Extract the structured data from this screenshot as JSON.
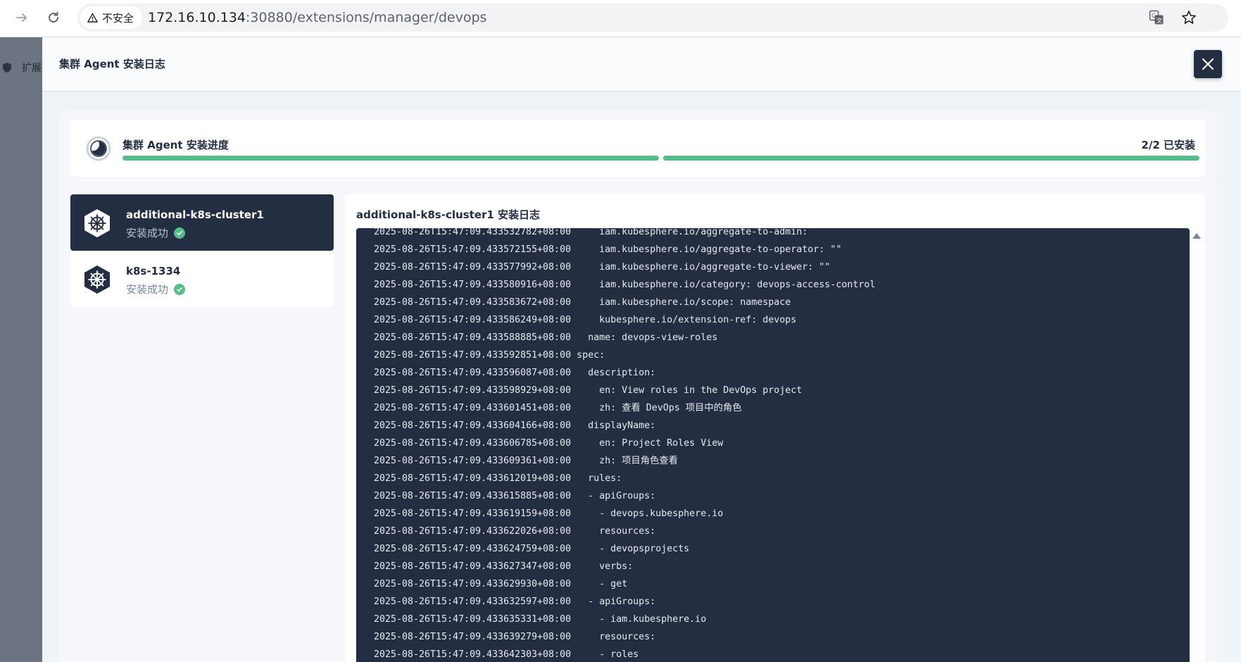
{
  "browser": {
    "security_label": "不安全",
    "url_host": "172.16.10.134",
    "url_path": ":30880/extensions/manager/devops"
  },
  "background": {
    "nav_label": "扩展"
  },
  "modal": {
    "title": "集群 Agent 安装日志",
    "progress": {
      "title": "集群 Agent 安装进度",
      "count_label": "2/2 已安装",
      "installed": 2,
      "total": 2,
      "bar_color": "#55bc8a"
    },
    "clusters": [
      {
        "name": "additional-k8s-cluster1",
        "status": "安装成功",
        "active": true
      },
      {
        "name": "k8s-1334",
        "status": "安装成功",
        "active": false
      }
    ],
    "log": {
      "title": "additional-k8s-cluster1 安装日志",
      "lines": [
        "2025-08-26T15:47:09.433532782+08:00     iam.kubesphere.io/aggregate-to-admin:",
        "2025-08-26T15:47:09.433572155+08:00     iam.kubesphere.io/aggregate-to-operator: \"\"",
        "2025-08-26T15:47:09.433577992+08:00     iam.kubesphere.io/aggregate-to-viewer: \"\"",
        "2025-08-26T15:47:09.433580916+08:00     iam.kubesphere.io/category: devops-access-control",
        "2025-08-26T15:47:09.433583672+08:00     iam.kubesphere.io/scope: namespace",
        "2025-08-26T15:47:09.433586249+08:00     kubesphere.io/extension-ref: devops",
        "2025-08-26T15:47:09.433588885+08:00   name: devops-view-roles",
        "2025-08-26T15:47:09.433592851+08:00 spec:",
        "2025-08-26T15:47:09.433596087+08:00   description:",
        "2025-08-26T15:47:09.433598929+08:00     en: View roles in the DevOps project",
        "2025-08-26T15:47:09.433601451+08:00     zh: 查看 DevOps 项目中的角色",
        "2025-08-26T15:47:09.433604166+08:00   displayName:",
        "2025-08-26T15:47:09.433606785+08:00     en: Project Roles View",
        "2025-08-26T15:47:09.433609361+08:00     zh: 项目角色查看",
        "2025-08-26T15:47:09.433612019+08:00   rules:",
        "2025-08-26T15:47:09.433615885+08:00   - apiGroups:",
        "2025-08-26T15:47:09.433619159+08:00     - devops.kubesphere.io",
        "2025-08-26T15:47:09.433622026+08:00     resources:",
        "2025-08-26T15:47:09.433624759+08:00     - devopsprojects",
        "2025-08-26T15:47:09.433627347+08:00     verbs:",
        "2025-08-26T15:47:09.433629930+08:00     - get",
        "2025-08-26T15:47:09.433632597+08:00   - apiGroups:",
        "2025-08-26T15:47:09.433635331+08:00     - iam.kubesphere.io",
        "2025-08-26T15:47:09.433639279+08:00     resources:",
        "2025-08-26T15:47:09.433642303+08:00     - roles"
      ]
    }
  },
  "icons": {
    "forward": "arrow-right-icon",
    "reload": "reload-icon",
    "warning": "warning-triangle-icon",
    "translate": "translate-icon",
    "bookmark": "star-icon",
    "close": "close-icon",
    "progress": "progress-pie-icon",
    "cluster": "helm-wheel-icon",
    "success": "check-circle-icon",
    "scroll": "scroll-up-icon"
  }
}
